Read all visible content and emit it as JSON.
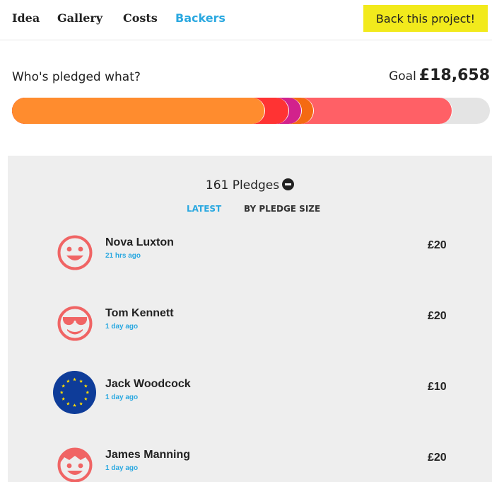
{
  "nav": {
    "tabs": [
      "Idea",
      "Gallery",
      "Costs",
      "Backers"
    ],
    "active_tab": "Backers",
    "back_button": "Back this project!"
  },
  "colors": {
    "accent": "#2aa8e0",
    "button": "#f2ea1c",
    "avatar": "#f06464"
  },
  "pledges": {
    "title": "Who's pledged what?",
    "goal_label": "Goal",
    "goal_amount": "£18,658",
    "progress_segments": [
      {
        "fraction": 0.53,
        "color": "#ff8c2e"
      },
      {
        "fraction": 0.05,
        "color": "#ff3333"
      },
      {
        "fraction": 0.027,
        "color": "#d2228c"
      },
      {
        "fraction": 0.025,
        "color": "#f46a12"
      },
      {
        "fraction": 0.29,
        "color": "#ff6066"
      }
    ]
  },
  "backers": {
    "count_label": "161 Pledges",
    "sort_latest": "LATEST",
    "sort_size": "BY PLEDGE SIZE",
    "list": [
      {
        "name": "Nova Luxton",
        "time": "21 hrs ago",
        "amount": "£20",
        "avatar": "smiley-face"
      },
      {
        "name": "Tom Kennett",
        "time": "1 day ago",
        "amount": "£20",
        "avatar": "sunglasses-face"
      },
      {
        "name": "Jack Woodcock",
        "time": "1 day ago",
        "amount": "£10",
        "avatar": "eu-flag"
      },
      {
        "name": "James Manning",
        "time": "1 day ago",
        "amount": "£20",
        "avatar": "hair-face"
      }
    ]
  }
}
